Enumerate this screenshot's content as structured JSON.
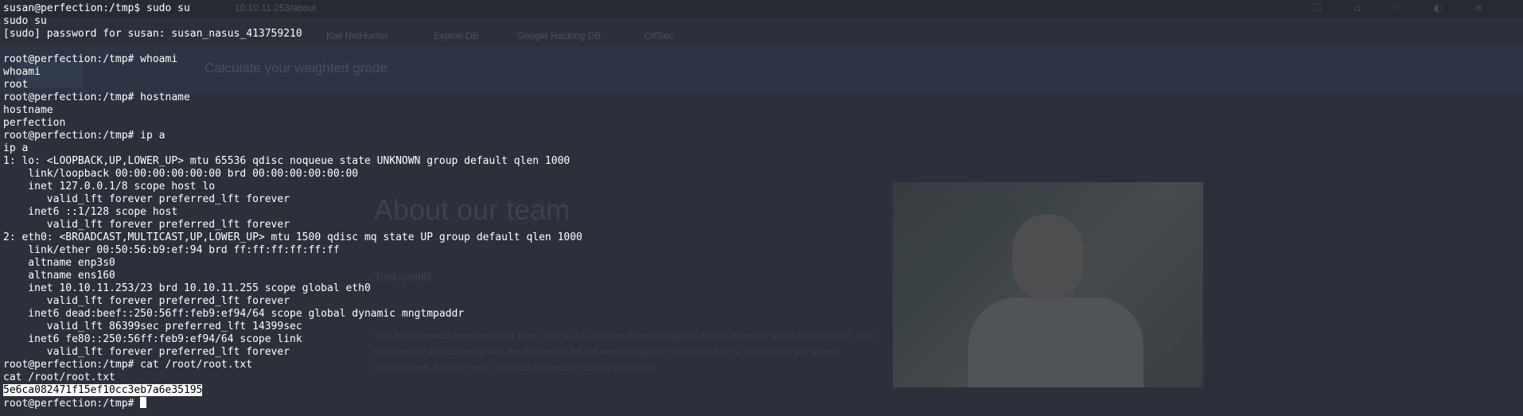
{
  "background": {
    "url_text": "10.10.11.253/about",
    "bookmarks": [
      "Kali NetHunter",
      "Exploit-DB",
      "Google Hacking DB",
      "OffSec"
    ],
    "header_title": "Calculate your weighted grade",
    "heading": "About our team",
    "member_name": "Tina Smith",
    "paragraph": "Tina is the newest member of our team. She is a Computer Science major at Acme University and a brilliant mind. She was the one who came up with the framework for the weighted grade calculator. She is an absolute wiz at web development, but she hasn't dabbled into secure coding that much."
  },
  "terminal": {
    "lines": [
      "susan@perfection:/tmp$ sudo su",
      "sudo su",
      "[sudo] password for susan: susan_nasus_413759210",
      "",
      "root@perfection:/tmp# whoami",
      "whoami",
      "root",
      "root@perfection:/tmp# hostname",
      "hostname",
      "perfection",
      "root@perfection:/tmp# ip a",
      "ip a",
      "1: lo: <LOOPBACK,UP,LOWER_UP> mtu 65536 qdisc noqueue state UNKNOWN group default qlen 1000",
      "    link/loopback 00:00:00:00:00:00 brd 00:00:00:00:00:00",
      "    inet 127.0.0.1/8 scope host lo",
      "       valid_lft forever preferred_lft forever",
      "    inet6 ::1/128 scope host",
      "       valid_lft forever preferred_lft forever",
      "2: eth0: <BROADCAST,MULTICAST,UP,LOWER_UP> mtu 1500 qdisc mq state UP group default qlen 1000",
      "    link/ether 00:50:56:b9:ef:94 brd ff:ff:ff:ff:ff:ff",
      "    altname enp3s0",
      "    altname ens160",
      "    inet 10.10.11.253/23 brd 10.10.11.255 scope global eth0",
      "       valid_lft forever preferred_lft forever",
      "    inet6 dead:beef::250:56ff:feb9:ef94/64 scope global dynamic mngtmpaddr",
      "       valid_lft 86399sec preferred_lft 14399sec",
      "    inet6 fe80::250:56ff:feb9:ef94/64 scope link",
      "       valid_lft forever preferred_lft forever",
      "root@perfection:/tmp# cat /root/root.txt",
      "cat /root/root.txt"
    ],
    "flag": "5e6ca082471f15ef10cc3eb7a6e35195",
    "prompt": "root@perfection:/tmp# "
  }
}
